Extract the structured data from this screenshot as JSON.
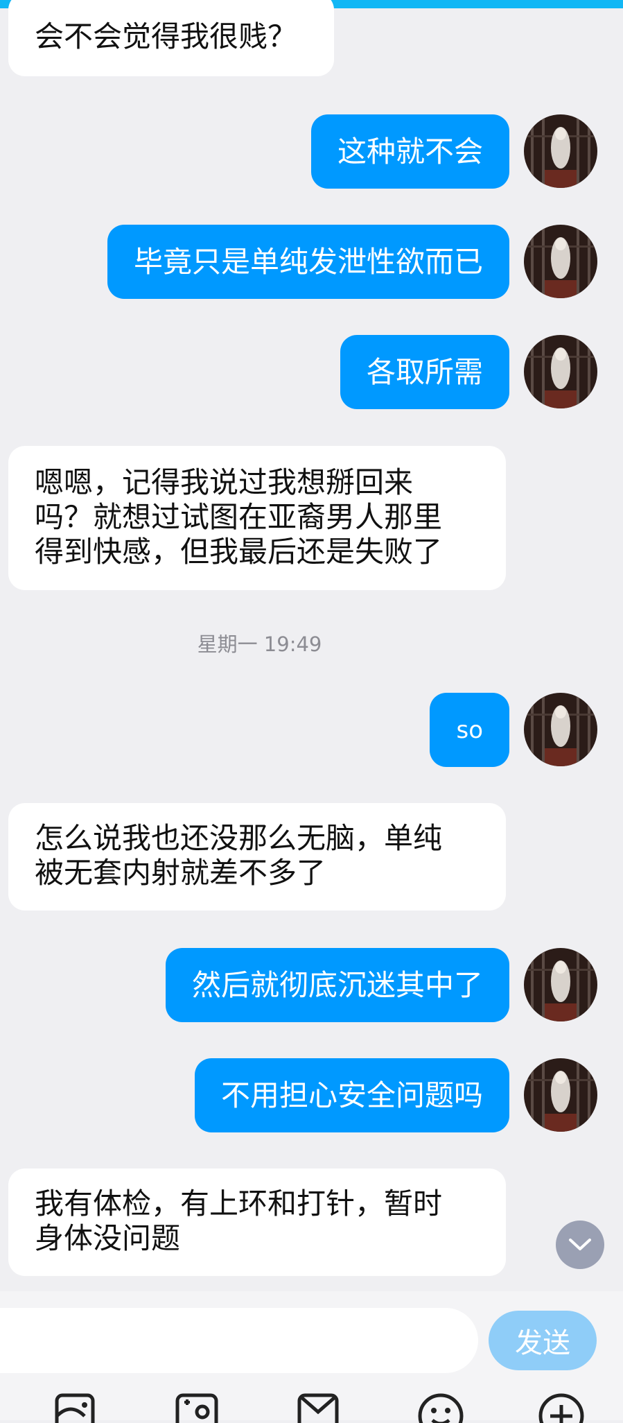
{
  "messages": [
    {
      "dir": "in",
      "text": "会不会觉得我很贱？"
    },
    {
      "dir": "out",
      "text": "这种就不会"
    },
    {
      "dir": "out",
      "text": "毕竟只是单纯发泄性欲而已"
    },
    {
      "dir": "out",
      "text": "各取所需"
    },
    {
      "dir": "in",
      "text": "嗯嗯，记得我说过我想掰回来\n吗？就想过试图在亚裔男人那里\n得到快感，但我最后还是失败了"
    },
    {
      "dir": "out",
      "text": "so"
    },
    {
      "dir": "in",
      "text": "怎么说我也还没那么无脑，单纯\n被无套内射就差不多了"
    },
    {
      "dir": "out",
      "text": "然后就彻底沉迷其中了"
    },
    {
      "dir": "out",
      "text": "不用担心安全问题吗"
    },
    {
      "dir": "in",
      "text": "我有体检，有上环和打针，暂时\n身体没问题"
    }
  ],
  "timestamp": "星期一 19:49",
  "input": {
    "value": "",
    "placeholder": ""
  },
  "send_label": "发送",
  "toolbar_icons": [
    "voice-icon",
    "image-icon",
    "camera-icon",
    "red-packet-icon",
    "emoji-icon",
    "plus-icon"
  ],
  "colors": {
    "accent_top": "#12b7f5",
    "outgoing_bubble": "#0099ff",
    "incoming_bubble": "#ffffff",
    "background": "#efeff2",
    "send_button": "#8fcdf8"
  }
}
